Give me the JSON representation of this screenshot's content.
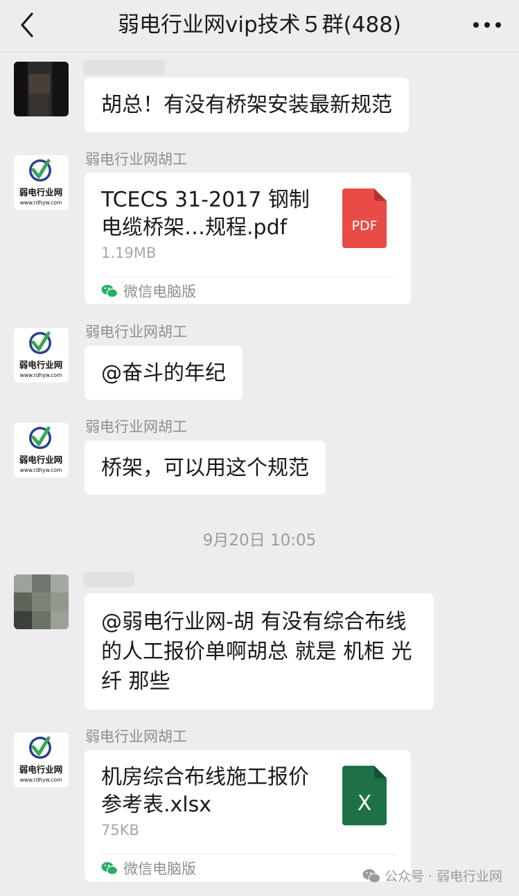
{
  "header": {
    "title": "弱电行业网vip技术５群(488)"
  },
  "messages": {
    "m1": {
      "text": "胡总！有没有桥架安装最新规范"
    },
    "m2": {
      "sender": "弱电行业网胡工",
      "file_name": "TCECS 31-2017 钢制电缆桥架…规程.pdf",
      "file_size": "1.19MB",
      "file_type": "PDF",
      "source": "微信电脑版"
    },
    "m3": {
      "sender": "弱电行业网胡工",
      "text": "@奋斗的年纪"
    },
    "m4": {
      "sender": "弱电行业网胡工",
      "text": "桥架，可以用这个规范"
    },
    "timestamp": "9月20日 10:05",
    "m5": {
      "text": "@弱电行业网-胡 有没有综合布线的人工报价单啊胡总 就是 机柜 光纤  那些"
    },
    "m6": {
      "sender": "弱电行业网胡工",
      "file_name": "机房综合布线施工报价参考表.xlsx",
      "file_size": "75KB",
      "file_type": "X",
      "source": "微信电脑版"
    }
  },
  "avatar_logo": {
    "brand": "弱电行业网",
    "url": "www.rdhyw.com"
  },
  "watermark": {
    "text": "公众号 · 弱电行业网"
  },
  "icons": {
    "back": "chevron-left-icon",
    "more": "more-dots-icon",
    "pdf": "pdf-file-icon",
    "excel": "excel-file-icon",
    "wechat": "wechat-icon"
  },
  "colors": {
    "background": "#ededed",
    "bubble": "#ffffff",
    "pdf_red": "#e94c47",
    "excel_green": "#1e7145",
    "wechat_green": "#2aae67"
  }
}
